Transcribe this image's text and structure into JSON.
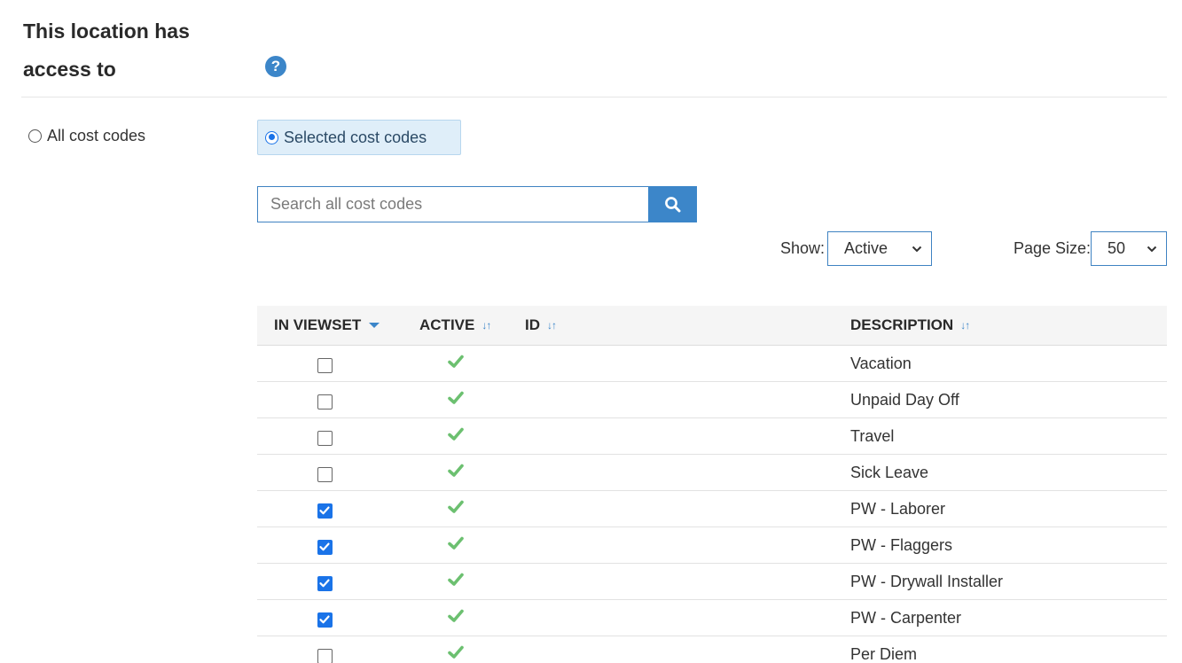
{
  "section": {
    "title_line1": "This location has",
    "title_line2": "access to",
    "help_icon_glyph": "?"
  },
  "access": {
    "all_label": "All cost codes",
    "all_selected": false,
    "selected_label": "Selected cost codes",
    "selected_selected": true
  },
  "search": {
    "placeholder": "Search all cost codes",
    "value": ""
  },
  "filters": {
    "show_label": "Show:",
    "show_value": "Active",
    "page_size_label": "Page Size:",
    "page_size_value": "50"
  },
  "table": {
    "headers": {
      "in_viewset": "IN VIEWSET",
      "active": "ACTIVE",
      "id": "ID",
      "description": "DESCRIPTION"
    },
    "rows": [
      {
        "in_viewset": false,
        "active": true,
        "id": "",
        "description": "Vacation"
      },
      {
        "in_viewset": false,
        "active": true,
        "id": "",
        "description": "Unpaid Day Off"
      },
      {
        "in_viewset": false,
        "active": true,
        "id": "",
        "description": "Travel"
      },
      {
        "in_viewset": false,
        "active": true,
        "id": "",
        "description": "Sick Leave"
      },
      {
        "in_viewset": true,
        "active": true,
        "id": "",
        "description": "PW - Laborer"
      },
      {
        "in_viewset": true,
        "active": true,
        "id": "",
        "description": "PW - Flaggers"
      },
      {
        "in_viewset": true,
        "active": true,
        "id": "",
        "description": "PW - Drywall Installer"
      },
      {
        "in_viewset": true,
        "active": true,
        "id": "",
        "description": "PW - Carpenter"
      },
      {
        "in_viewset": false,
        "active": true,
        "id": "",
        "description": "Per Diem"
      }
    ]
  },
  "colors": {
    "accent": "#3c86c9",
    "checkbox_checked": "#1a73e8",
    "active_check": "#6cc070",
    "selected_radio_bg": "#dfeef9"
  }
}
